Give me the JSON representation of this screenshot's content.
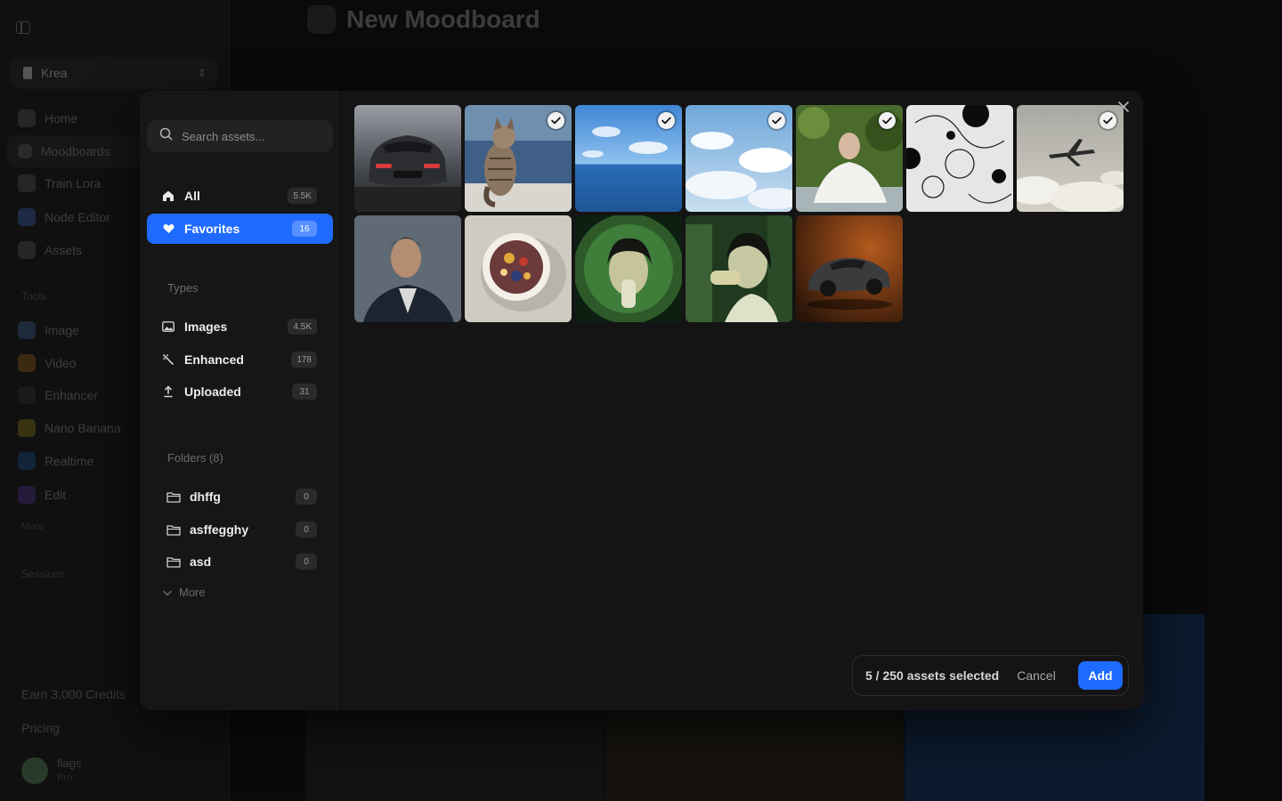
{
  "background": {
    "workspace": "Krea",
    "nav": [
      "Home",
      "Moodboards",
      "Train Lora",
      "Node Editor",
      "Assets"
    ],
    "tools_heading": "Tools",
    "tools": [
      "Image",
      "Video",
      "Enhancer",
      "Nano Banana",
      "Realtime",
      "Edit"
    ],
    "more_tools": "More",
    "sessions_heading": "Sessions",
    "earn": "Earn 3,000 Credits",
    "pricing": "Pricing",
    "user_name": "flags",
    "user_plan": "Pro",
    "page_title": "New Moodboard"
  },
  "modal": {
    "search_placeholder": "Search assets...",
    "filters": [
      {
        "label": "All",
        "count": "5.5K"
      },
      {
        "label": "Favorites",
        "count": "16"
      }
    ],
    "types_heading": "Types",
    "types": [
      {
        "label": "Images",
        "count": "4.5K"
      },
      {
        "label": "Enhanced",
        "count": "178"
      },
      {
        "label": "Uploaded",
        "count": "31"
      }
    ],
    "folders_heading": "Folders (8)",
    "folders": [
      {
        "label": "dhffg",
        "count": "0"
      },
      {
        "label": "asffegghy",
        "count": "0"
      },
      {
        "label": "asd",
        "count": "0"
      }
    ],
    "more_label": "More",
    "selection_status": "5 / 250 assets selected",
    "cancel_label": "Cancel",
    "add_label": "Add",
    "assets": [
      {
        "name": "sports-car-front",
        "selected": false
      },
      {
        "name": "tabby-cat-by-sea",
        "selected": true
      },
      {
        "name": "ocean-horizon",
        "selected": true
      },
      {
        "name": "clouds-sky",
        "selected": true
      },
      {
        "name": "woman-in-robe",
        "selected": true
      },
      {
        "name": "black-white-pattern",
        "selected": false
      },
      {
        "name": "airplane-in-clouds",
        "selected": true
      },
      {
        "name": "man-portrait",
        "selected": false
      },
      {
        "name": "smoothie-bowl",
        "selected": false
      },
      {
        "name": "girl-drinking-fisheye",
        "selected": false
      },
      {
        "name": "girl-drinking-store",
        "selected": false
      },
      {
        "name": "classic-porsche",
        "selected": false
      }
    ]
  }
}
